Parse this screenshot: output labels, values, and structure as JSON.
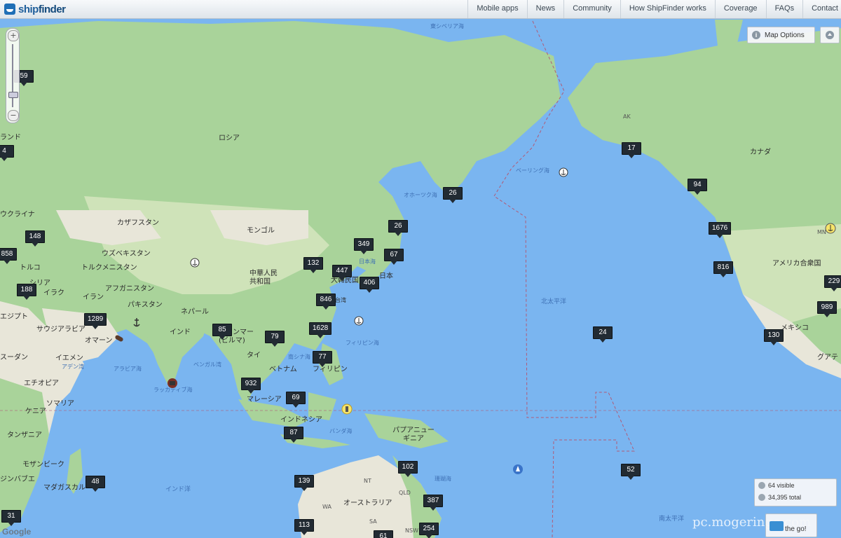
{
  "header": {
    "logo_text_a": "ship",
    "logo_text_b": "finder",
    "nav": [
      "Mobile apps",
      "News",
      "Community",
      "How ShipFinder works",
      "Coverage",
      "FAQs",
      "Contact"
    ]
  },
  "controls": {
    "map_options_label": "Map Options",
    "visible_count": "64 visible",
    "total_count": "34,395 total",
    "on_the_go": "the go!",
    "zoom_in": "+",
    "zoom_out": "−"
  },
  "attribution": "Google",
  "watermark": "pc.mogeringo.com",
  "colors": {
    "water": "#7ab5f0",
    "land": "#a9d39a",
    "cluster_bg": "#222b33",
    "brand": "#1f6fb6"
  },
  "places": {
    "sea_labels": [
      "東シベリア海",
      "オホーツク海",
      "ベーリング海",
      "日本海",
      "フィリピン海",
      "南シナ海",
      "アラビア海",
      "ベンガル湾",
      "ラッカディブ海",
      "バンダ海",
      "珊瑚海",
      "アデン湾"
    ],
    "ocean_labels": [
      "北太平洋",
      "インド洋",
      "南太平洋"
    ],
    "countries": [
      "ロシア",
      "カナダ",
      "カザフスタン",
      "モンゴル",
      "ウズベキスタン",
      "トルクメニスタン",
      "中華人民共和国",
      "アフガニスタン",
      "イラン",
      "イラク",
      "シリア",
      "トルコ",
      "パキスタン",
      "ネパール",
      "インド",
      "サウジアラビア",
      "オマーン",
      "イエメン",
      "エジプト",
      "スーダン",
      "エチオピア",
      "ソマリア",
      "ケニア",
      "タンザニア",
      "モザンビーク",
      "ジンバブエ",
      "マダガスカル",
      "ミャンマー(ビルマ)",
      "タイ",
      "ベトナム",
      "フィリピン",
      "マレーシア",
      "インドネシア",
      "パプアニューギニア",
      "オーストラリア",
      "日本",
      "大韓民国",
      "台湾",
      "アメリカ合衆国",
      "メキシコ",
      "グアテ",
      "ウクライナ",
      "ランド"
    ],
    "state_labels": [
      "NT",
      "QLD",
      "WA",
      "SA",
      "NSW",
      "AK",
      "MN"
    ]
  },
  "clusters": [
    "59",
    "4",
    "148",
    "858",
    "188",
    "1289",
    "85",
    "79",
    "932",
    "69",
    "87",
    "77",
    "1628",
    "846",
    "132",
    "447",
    "406",
    "349",
    "67",
    "26",
    "26",
    "17",
    "94",
    "1676",
    "816",
    "24",
    "130",
    "989",
    "229",
    "102",
    "139",
    "387",
    "113",
    "254",
    "61",
    "52",
    "48",
    "31"
  ]
}
